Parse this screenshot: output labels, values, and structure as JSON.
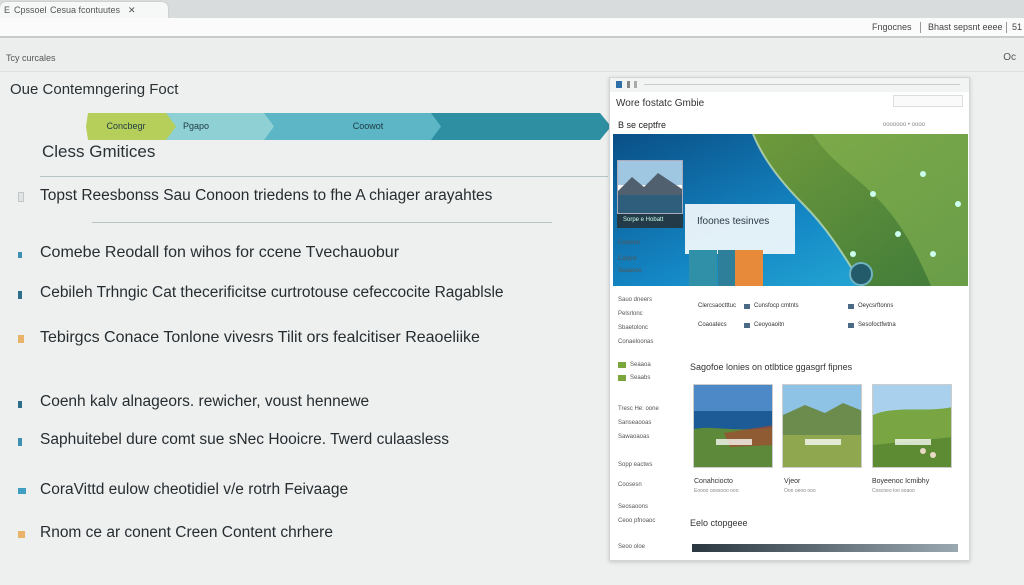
{
  "browser": {
    "tab_left": "E",
    "tab_title": "Cpssoel",
    "tab_site": "Cesua fcontuutes",
    "address_right1": "Fngocnes",
    "address_right2": "Bhast sepsnt eeee",
    "address_right3": "51",
    "bar_label": "Tcy curcales",
    "bar_right": "Oc"
  },
  "main": {
    "title": "Oue Contemngering Foct",
    "flow_steps": [
      "Concbegr",
      "Pgapo",
      "Coowot"
    ],
    "subtitle": "Cless Gmitices",
    "items": [
      "Topst Reesbonss Sau Conoon triedens to fhe  A chiager arayahtes",
      "Comebe Reodall fon wihos for ccene Tvechauobur",
      "Cebileh Trhngic Cat thecerificitse curtrotouse cefeccocite Ragablsle",
      "Tebirgcs Conace Tonlone vivesrs  Tilit ors fealcitiser Reaoeliike",
      "Coenh kalv alnageors. rewicher, voust hennewe",
      "Saphuitebel dure comt sue sNec Hooicre. Twerd culaasless",
      "CoraVittd eulow cheotidiel v/e rotrh Feivaage",
      "Rnom ce ar conent Creen  Content chrhere"
    ]
  },
  "panel": {
    "title": "Wore fostatc Gmbie",
    "subtitle": "B se ceptfre",
    "subtitle_right": "ooooooo • oooo",
    "hero_card": "Ifoones tesinves",
    "hero_thumb_label": "Sorpe e Hobatt",
    "side_items": [
      "Cowoon",
      "Cadyst",
      "Seaaoos",
      "Sauo dneers",
      "Pelsrlonc",
      "Sbaetolonc",
      "Conaeloonas",
      "Seaaoa",
      "Seaabs",
      "Tresc He: oone",
      "Sanseaooas",
      "Sawaoaoas",
      "Sopp eactws",
      "Coosesn",
      "Seosaoons",
      "Ceoo pfnoaoc",
      "Seoo oloe"
    ],
    "links": [
      [
        "Clercsaoctttuc",
        "Cunsfocp cmtnts",
        "Oeycsrftonns"
      ],
      [
        "Coaoatecs",
        "Ceoyoaoitn",
        "Sesofoctfwtna"
      ]
    ],
    "section1": "Sagofoe lonies on otlbtice ggasgrf fipnes",
    "photos": [
      {
        "caption": "Conahciocto",
        "sub": "Eoooo oossooo ooo"
      },
      {
        "caption": "Vjeor",
        "sub": "Oon oeoo ooo"
      },
      {
        "caption": "Boyeenoc Icmibhy",
        "sub": "Coscneo loo soaoo"
      }
    ],
    "section2": "Eelo ctopgeee"
  },
  "colors": {
    "flow1": "#b5cd57",
    "flow2": "#7fccd1",
    "flow3": "#3f9fae",
    "bullet_blue": "#3f8fb1",
    "bullet_orange": "#eab36a"
  }
}
